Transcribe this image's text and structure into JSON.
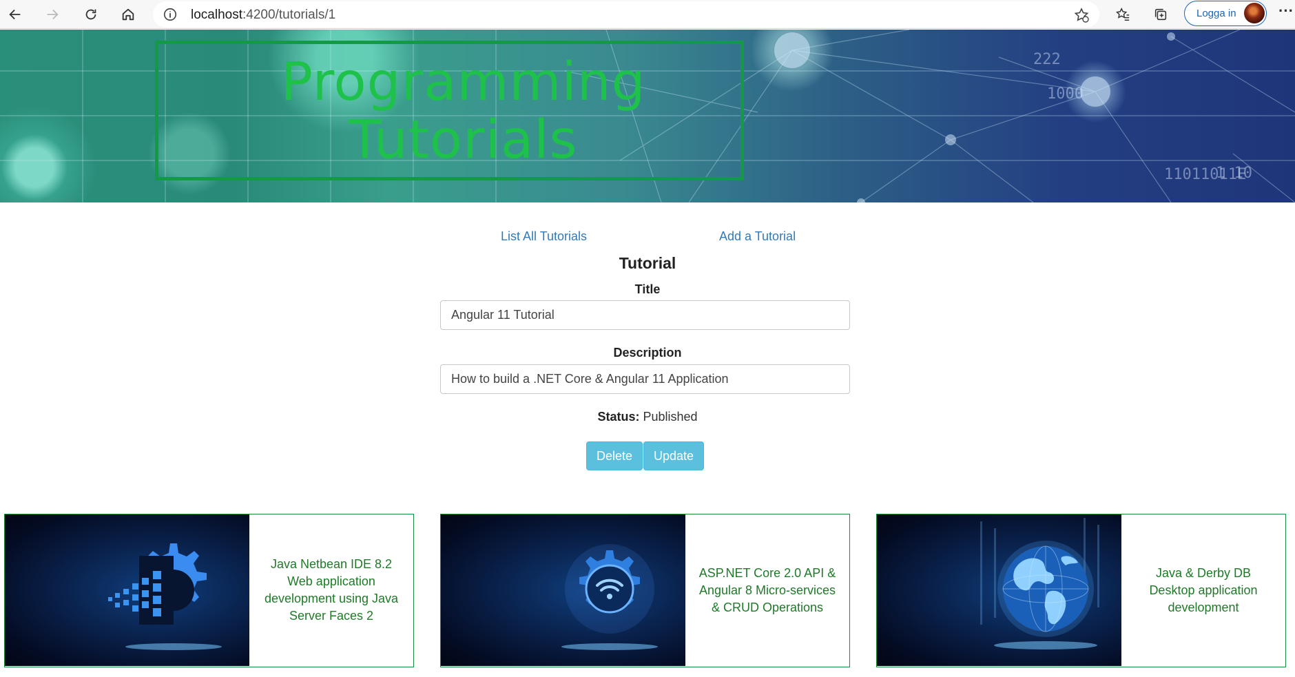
{
  "browser": {
    "url_host": "localhost",
    "url_path": ":4200/tutorials/1",
    "login_label": "Logga in",
    "more_label": "···"
  },
  "banner": {
    "title_line1": "Programming",
    "title_line2": "Tutorials"
  },
  "nav": {
    "list_all": "List All Tutorials",
    "add": "Add a Tutorial"
  },
  "form": {
    "heading": "Tutorial",
    "title_label": "Title",
    "title_value": "Angular 11 Tutorial",
    "description_label": "Description",
    "description_value": "How to build a .NET Core & Angular 11 Application",
    "status_label": "Status:",
    "status_value": "Published",
    "delete_label": "Delete",
    "update_label": "Update"
  },
  "cards": [
    {
      "text": "Java Netbean IDE 8.2 Web application development using Java Server Faces 2",
      "icon": "gear-pixels-icon"
    },
    {
      "text": "ASP.NET Core 2.0 API & Angular 8 Micro-services & CRUD Operations",
      "icon": "gear-wifi-icon"
    },
    {
      "text": "Java & Derby DB Desktop application development",
      "icon": "globe-icon"
    }
  ],
  "colors": {
    "banner_title": "#1ec24a",
    "link": "#337ab7",
    "button": "#5bc0de",
    "card_text": "#1f7a28"
  }
}
